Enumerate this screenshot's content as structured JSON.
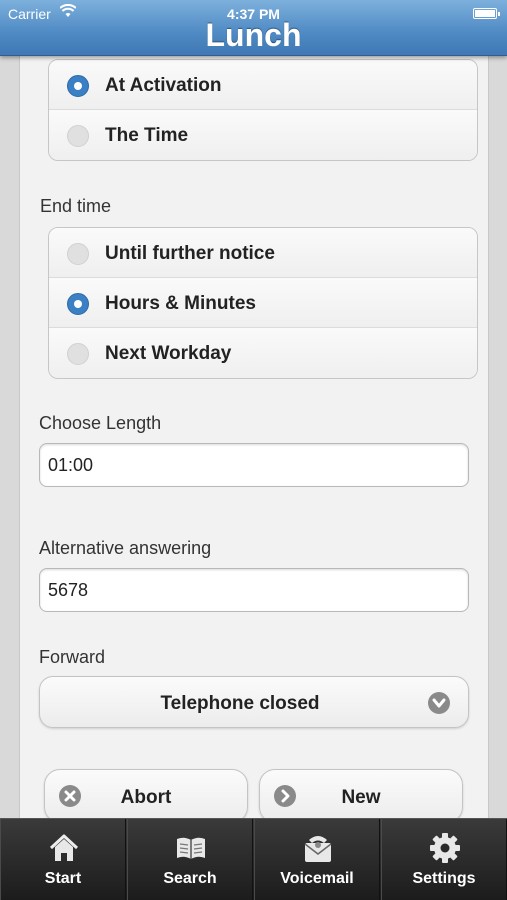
{
  "status_bar": {
    "carrier": "Carrier",
    "time": "4:37 PM"
  },
  "nav": {
    "title": "Lunch"
  },
  "start_group": {
    "options": [
      {
        "label": "At Activation",
        "selected": true
      },
      {
        "label": "The Time",
        "selected": false
      }
    ]
  },
  "end_time": {
    "label": "End time",
    "options": [
      {
        "label": "Until further notice",
        "selected": false
      },
      {
        "label": "Hours & Minutes",
        "selected": true
      },
      {
        "label": "Next Workday",
        "selected": false
      }
    ]
  },
  "length": {
    "label": "Choose Length",
    "value": "01:00"
  },
  "alt": {
    "label": "Alternative answering",
    "value": "5678"
  },
  "forward": {
    "label": "Forward",
    "value": "Telephone closed"
  },
  "buttons": {
    "abort": "Abort",
    "new": "New"
  },
  "tabs": [
    {
      "label": "Start",
      "icon": "home-icon"
    },
    {
      "label": "Search",
      "icon": "book-icon"
    },
    {
      "label": "Voicemail",
      "icon": "voicemail-icon"
    },
    {
      "label": "Settings",
      "icon": "gear-icon"
    }
  ],
  "colors": {
    "nav": "#4f8ac4",
    "radio_on": "#3b7fc4",
    "tabbar": "#1c1c1c"
  }
}
